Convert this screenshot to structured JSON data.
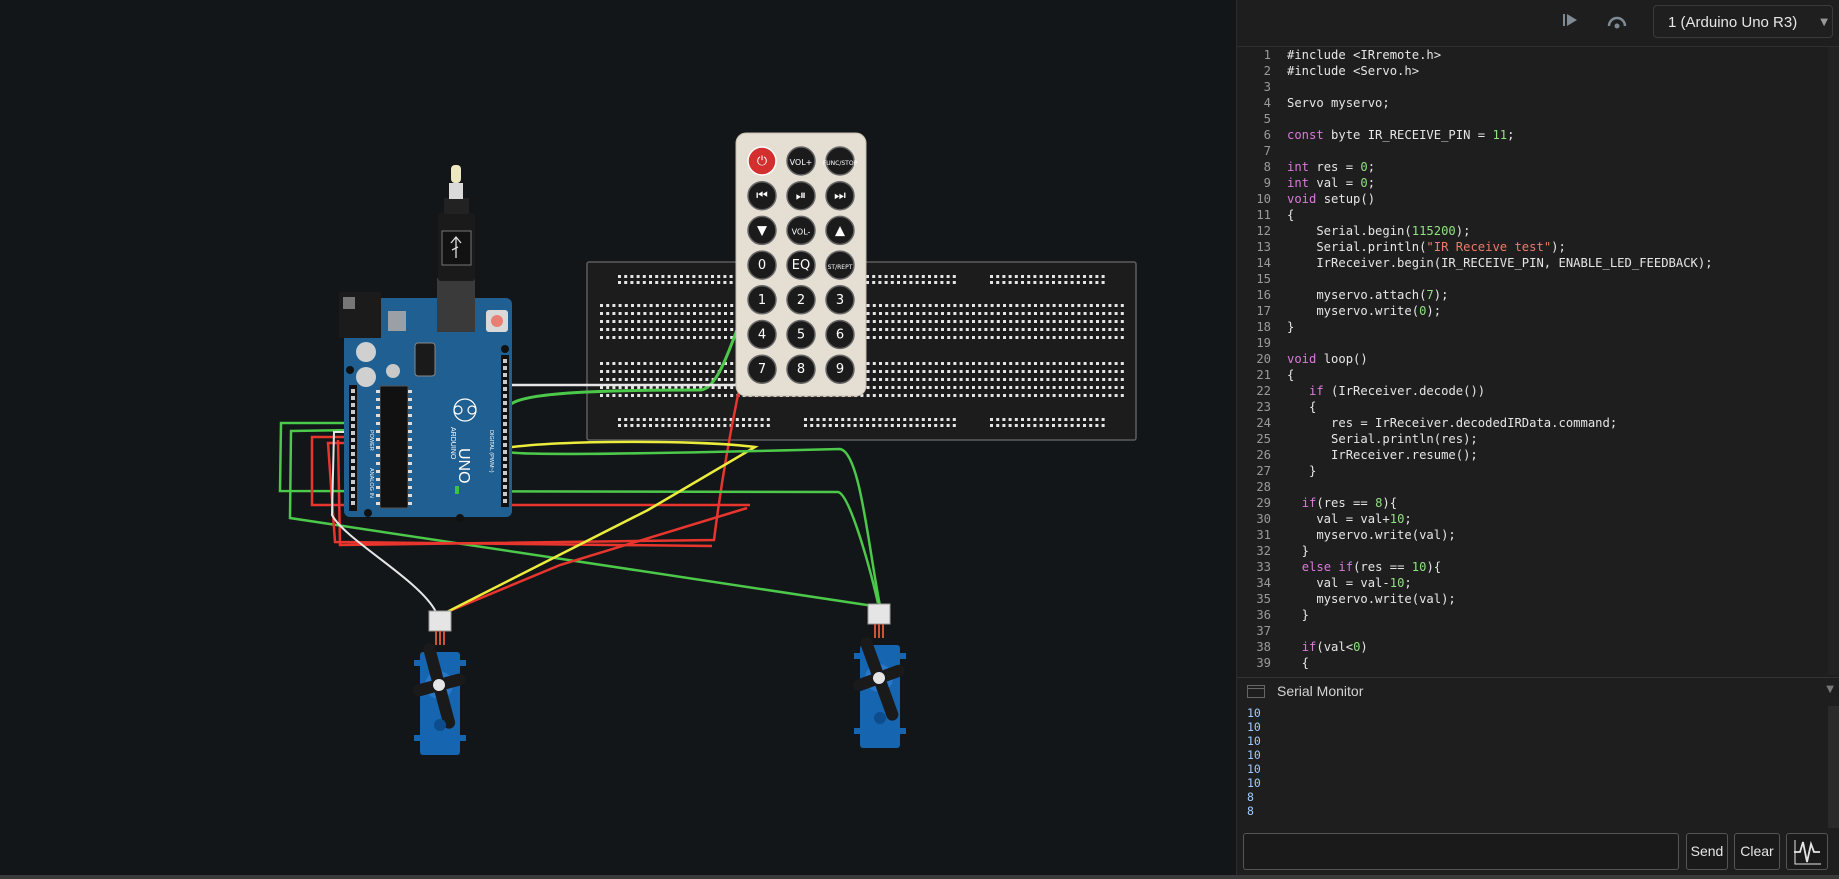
{
  "toolbar": {
    "step_icon": "step-over-icon",
    "resume_icon": "resume-icon",
    "board": "1 (Arduino Uno R3)",
    "board_chevron": "chevron-down-icon"
  },
  "remote": {
    "keys": [
      "⏻",
      "VOL+",
      "FUNC/STOP",
      "⏮",
      "⏯",
      "⏭",
      "▼",
      "VOL-",
      "▲",
      "0",
      "EQ",
      "ST/REPT",
      "1",
      "2",
      "3",
      "4",
      "5",
      "6",
      "7",
      "8",
      "9"
    ]
  },
  "arduino": {
    "brand": "ARDUINO",
    "model": "UNO",
    "header_digital": "DIGITAL (PWM~)",
    "header_power": "POWER",
    "header_analog": "ANALOG IN"
  },
  "editor": {
    "lines": [
      "#include <IRremote.h>",
      "#include <Servo.h>",
      "",
      "Servo myservo;",
      "",
      "const byte IR_RECEIVE_PIN = 11;",
      "",
      "int res = 0;",
      "int val = 0;",
      "void setup()",
      "{",
      "    Serial.begin(115200);",
      "    Serial.println(\"IR Receive test\");",
      "    IrReceiver.begin(IR_RECEIVE_PIN, ENABLE_LED_FEEDBACK);",
      "",
      "    myservo.attach(7);",
      "    myservo.write(0);",
      "}",
      "",
      "void loop()",
      "{",
      "   if (IrReceiver.decode())",
      "   {",
      "      res = IrReceiver.decodedIRData.command;",
      "      Serial.println(res);",
      "      IrReceiver.resume();",
      "   }",
      "",
      "  if(res == 8){",
      "    val = val+10;",
      "    myservo.write(val);",
      "  }",
      "  else if(res == 10){",
      "    val = val-10;",
      "    myservo.write(val);",
      "  }",
      "",
      "  if(val<0)",
      "  {"
    ]
  },
  "serial": {
    "title": "Serial Monitor",
    "lines": [
      "10",
      "10",
      "10",
      "10",
      "10",
      "10",
      "8",
      "8"
    ],
    "input_value": "",
    "send_label": "Send",
    "clear_label": "Clear",
    "plotter_icon": "plotter-icon"
  },
  "colors": {
    "background": "#121618",
    "wire_green": "#4cc84a",
    "wire_red": "#e8352d",
    "wire_yellow": "#ecec3c",
    "wire_white": "#e6e6e6",
    "arduino_blue": "#1f5f91",
    "breadboard": "#1c1c1c",
    "remote_body": "#e5ded3",
    "servo_blue": "#1565b0"
  }
}
